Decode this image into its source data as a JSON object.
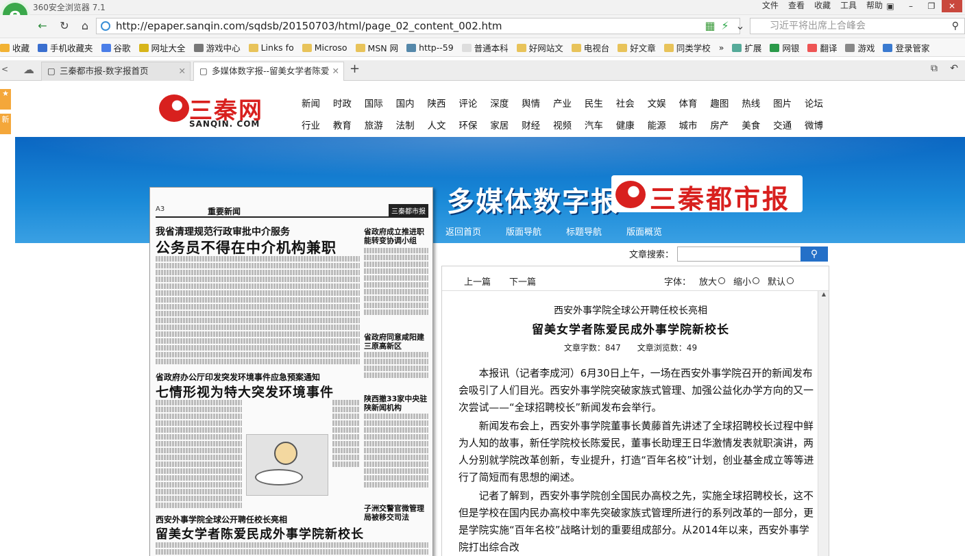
{
  "browser": {
    "title": "360安全浏览器 7.1",
    "menus": [
      "文件",
      "查看",
      "收藏",
      "工具",
      "帮助"
    ],
    "url": "http://epaper.sanqin.com/sqdsb/20150703/html/page_02_content_002.htm",
    "search_placeholder": "习近平将出席上合峰会",
    "bookmarks": [
      "收藏",
      "手机收藏夹",
      "谷歌",
      "网址大全",
      "游戏中心",
      "Links fo",
      "Microso",
      "MSN 网",
      "http--59",
      "普通本科",
      "好网站文",
      "电视台",
      "好文章",
      "同类学校",
      "扩展",
      "网银",
      "翻译",
      "游戏",
      "登录管家"
    ],
    "tabs": [
      {
        "label": "三秦都市报-数字报首页"
      },
      {
        "label": "多媒体数字报--留美女学者陈爱"
      }
    ]
  },
  "site": {
    "logo_cn": "三秦网",
    "logo_en": "SANQIN. COM",
    "nav_row1": [
      "新闻",
      "时政",
      "国际",
      "国内",
      "陕西",
      "评论",
      "深度",
      "舆情",
      "产业",
      "民生",
      "社会",
      "文娱",
      "体育",
      "趣图",
      "热线",
      "图片",
      "论坛"
    ],
    "nav_row2": [
      "行业",
      "教育",
      "旅游",
      "法制",
      "人文",
      "环保",
      "家居",
      "财经",
      "视频",
      "汽车",
      "健康",
      "能源",
      "城市",
      "房产",
      "美食",
      "交通",
      "微博"
    ],
    "banner_title": "多媒体数字报",
    "banner_brand": "三秦都市报",
    "subnav": [
      "返回首页",
      "版面导航",
      "标题导航",
      "版面概览"
    ],
    "search_label": "文章搜索："
  },
  "newspaper": {
    "page_label": "A3",
    "section": "重要新闻",
    "masthead": "三秦都市报",
    "headline1_sub": "我省清理规范行政审批中介服务",
    "headline1": "公务员不得在中介机构兼职",
    "headline2_sub": "省政府办公厅印发突发环境事件应急预案通知",
    "headline2": "七情形视为特大突发环境事件",
    "headline3_sub": "西安外事学院全球公开聘任校长亮相",
    "headline3": "留美女学者陈爱民成外事学院新校长",
    "side1": "省政府成立推进职能转变协调小组",
    "side2": "省政府同意咸阳建三原高新区",
    "side3": "陕西撤33家中央驻陕新闻机构",
    "side4": "子洲交警官微管理局被移交司法"
  },
  "article": {
    "prev": "上一篇",
    "next": "下一篇",
    "font_label": "字体：",
    "font_bigger": "放大",
    "font_smaller": "缩小",
    "font_default": "默认",
    "kicker": "西安外事学院全球公开聘任校长亮相",
    "title": "留美女学者陈爱民成外事学院新校长",
    "meta": "文章字数：847　　文章浏览数：49",
    "paragraphs": [
      "本报讯（记者李成河）6月30日上午，一场在西安外事学院召开的新闻发布会吸引了人们目光。西安外事学院突破家族式管理、加强公益化办学方向的又一次尝试——“全球招聘校长”新闻发布会举行。",
      "新闻发布会上，西安外事学院董事长黄藤首先讲述了全球招聘校长过程中鲜为人知的故事，新任学院校长陈爱民，董事长助理王日华激情发表就职演讲，两人分别就学院改革创新，专业提升，打造“百年名校”计划，创业基金成立等等进行了简短而有思想的阐述。",
      "记者了解到，西安外事学院创全国民办高校之先，实施全球招聘校长，这不但是学校在国内民办高校中率先突破家族式管理所进行的系列改革的一部分，更是学院实施“百年名校”战略计划的重要组成部分。从2014年以来，西安外事学院打出综合改"
    ]
  }
}
